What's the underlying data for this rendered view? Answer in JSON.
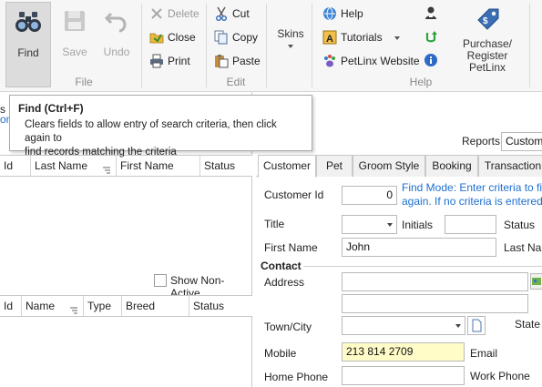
{
  "ribbon": {
    "find_label": "Find",
    "save_label": "Save",
    "undo_label": "Undo",
    "file_group_label": "File",
    "delete_label": "Delete",
    "close_label": "Close",
    "print_label": "Print",
    "cut_label": "Cut",
    "copy_label": "Copy",
    "paste_label": "Paste",
    "edit_group_label": "Edit",
    "skins_label": "Skins",
    "help_label": "Help",
    "tutorials_label": "Tutorials",
    "petlinx_label": "PetLinx Website",
    "help_group_label": "Help",
    "purchase_label_line1": "Purchase/",
    "purchase_label_line2": "Register PetLinx"
  },
  "tooltip": {
    "title": "Find (Ctrl+F)",
    "line1": "Clears fields to allow entry of search criteria, then click again to",
    "line2": "find records matching the criteria"
  },
  "left": {
    "partial_tab_text": "s (",
    "partial_link_text": "om",
    "customer_grid": {
      "columns": [
        "Id",
        "Last Name",
        "First Name",
        "Status"
      ]
    },
    "show_non_active_label": "Show Non-Active",
    "pet_grid": {
      "columns": [
        "Id",
        "Name",
        "Type",
        "Breed",
        "Status"
      ]
    }
  },
  "right": {
    "reports_label": "Reports",
    "reports_value": "Custome",
    "tabs": [
      "Customer",
      "Pet",
      "Groom Style",
      "Booking",
      "Transaction"
    ],
    "active_tab": "Customer",
    "customer_id_label": "Customer Id",
    "customer_id_value": "0",
    "hint_line1": "Find Mode: Enter criteria to find",
    "hint_line2": "again. If no criteria is entered, a",
    "title_label": "Title",
    "title_value": "",
    "initials_label": "Initials",
    "initials_value": "",
    "status_label": "Status",
    "first_name_label": "First Name",
    "first_name_value": "John",
    "last_name_label": "Last Nam",
    "contact_section": "Contact",
    "address_label": "Address",
    "address_line1": "",
    "address_line2": "",
    "town_label": "Town/City",
    "town_value": "",
    "state_label": "State",
    "mobile_label": "Mobile",
    "mobile_value": "213 814 2709",
    "email_label": "Email",
    "home_phone_label": "Home Phone",
    "home_phone_value": "",
    "work_phone_label": "Work Phone"
  },
  "colors": {
    "accent_blue": "#1e6fd0",
    "highlight_field": "#fffcc8",
    "ribbon_bg": "#f6f6f6"
  }
}
